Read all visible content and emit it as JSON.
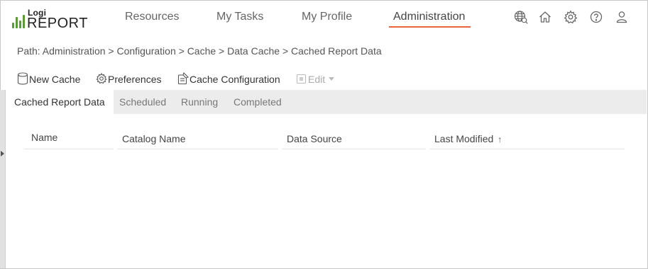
{
  "app": {
    "logo_top": "Logi",
    "logo_bottom": "REPORT",
    "brand_color": "#5a9a3a",
    "accent_color": "#e8663d"
  },
  "nav": {
    "items": [
      {
        "label": "Resources"
      },
      {
        "label": "My Tasks"
      },
      {
        "label": "My Profile"
      },
      {
        "label": "Administration",
        "active": true
      }
    ]
  },
  "header_icons": [
    "globe-search-icon",
    "home-icon",
    "gear-icon",
    "help-icon",
    "user-icon"
  ],
  "breadcrumb": "Path: Administration > Configuration > Cache > Data Cache > Cached Report Data",
  "toolbar": {
    "new_cache": "New Cache",
    "preferences": "Preferences",
    "cache_configuration": "Cache Configuration",
    "edit": "Edit"
  },
  "tabs": [
    {
      "label": "Cached Report Data",
      "active": true
    },
    {
      "label": "Scheduled"
    },
    {
      "label": "Running"
    },
    {
      "label": "Completed"
    }
  ],
  "table": {
    "columns": [
      "Name",
      "Catalog Name",
      "Data Source",
      "Last Modified"
    ],
    "sort_column": "Last Modified",
    "sort_direction": "ascending",
    "rows": []
  }
}
